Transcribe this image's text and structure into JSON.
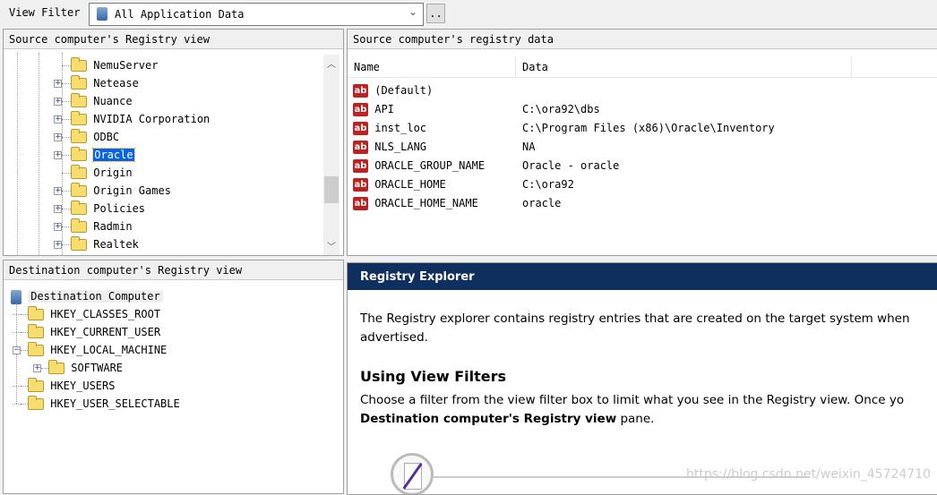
{
  "toolbar": {
    "view_filter_label": "View Filter",
    "view_filter_value": "All Application Data",
    "browse_label": ".."
  },
  "source_tree": {
    "title": "Source computer's Registry view",
    "items": [
      {
        "label": "NemuServer",
        "expandable": false
      },
      {
        "label": "Netease",
        "expandable": true
      },
      {
        "label": "Nuance",
        "expandable": true
      },
      {
        "label": "NVIDIA Corporation",
        "expandable": true
      },
      {
        "label": "ODBC",
        "expandable": true
      },
      {
        "label": "Oracle",
        "expandable": true,
        "selected": true
      },
      {
        "label": "Origin",
        "expandable": false
      },
      {
        "label": "Origin Games",
        "expandable": true
      },
      {
        "label": "Policies",
        "expandable": true
      },
      {
        "label": "Radmin",
        "expandable": true
      },
      {
        "label": "Realtek",
        "expandable": true
      }
    ]
  },
  "source_data": {
    "title": "Source computer's registry data",
    "columns": [
      "Name",
      "Data"
    ],
    "rows": [
      {
        "name": "(Default)",
        "data": ""
      },
      {
        "name": "API",
        "data": "C:\\ora92\\dbs"
      },
      {
        "name": "inst_loc",
        "data": "C:\\Program Files (x86)\\Oracle\\Inventory"
      },
      {
        "name": "NLS_LANG",
        "data": "NA"
      },
      {
        "name": "ORACLE_GROUP_NAME",
        "data": "Oracle - oracle"
      },
      {
        "name": "ORACLE_HOME",
        "data": "C:\\ora92"
      },
      {
        "name": "ORACLE_HOME_NAME",
        "data": "oracle"
      }
    ]
  },
  "dest_tree": {
    "title": "Destination computer's Registry view",
    "root": "Destination Computer",
    "items": [
      {
        "label": "HKEY_CLASSES_ROOT",
        "level": 1,
        "toggle": ""
      },
      {
        "label": "HKEY_CURRENT_USER",
        "level": 1,
        "toggle": ""
      },
      {
        "label": "HKEY_LOCAL_MACHINE",
        "level": 1,
        "toggle": "-"
      },
      {
        "label": "SOFTWARE",
        "level": 2,
        "toggle": "+"
      },
      {
        "label": "HKEY_USERS",
        "level": 1,
        "toggle": ""
      },
      {
        "label": "HKEY_USER_SELECTABLE",
        "level": 1,
        "toggle": ""
      }
    ]
  },
  "help": {
    "title": "Registry Explorer",
    "intro": "The Registry explorer contains registry entries that are created on the target system when",
    "intro2": "advertised.",
    "heading": "Using View Filters",
    "para": "Choose a filter from the view filter box to limit what you see in the Registry view. Once yo",
    "para_bold": "Destination computer's Registry view",
    "para_end": " pane.",
    "header_color": "#0f2f5f"
  },
  "watermark": "https://blog.csdn.net/weixin_45724710"
}
